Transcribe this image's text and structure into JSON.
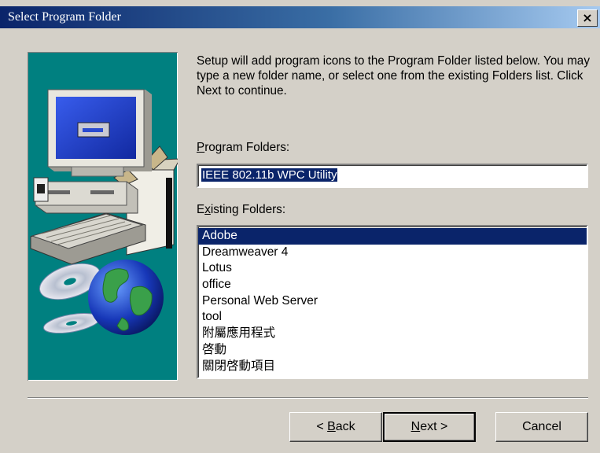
{
  "window": {
    "title": "Select Program Folder",
    "close_glyph": "×"
  },
  "description": "Setup will add program icons to the Program Folder listed below. You may type a new folder name, or select one from the existing Folders list.  Click Next to continue.",
  "program_folders": {
    "label_accel": "P",
    "label_rest": "rogram Folders:",
    "value": "IEEE 802.11b WPC Utility"
  },
  "existing_folders": {
    "label_pre": "E",
    "label_accel": "x",
    "label_rest": "isting Folders:",
    "items": [
      "Adobe",
      "Dreamweaver 4",
      "Lotus",
      "office",
      "Personal Web Server",
      "tool",
      "附屬應用程式",
      "啓動",
      "關閉啓動項目"
    ],
    "selected_index": 0
  },
  "buttons": {
    "back_prefix": "< ",
    "back_accel": "B",
    "back_rest": "ack",
    "next_accel": "N",
    "next_rest": "ext >",
    "cancel": "Cancel"
  },
  "colors": {
    "titlebar": "#0a246a",
    "panel": "#008080",
    "selection": "#0a246a",
    "dialog": "#d4d0c8"
  },
  "icons": [
    "close-icon",
    "computer-illustration",
    "globe-icon",
    "cd-disc-icon"
  ]
}
